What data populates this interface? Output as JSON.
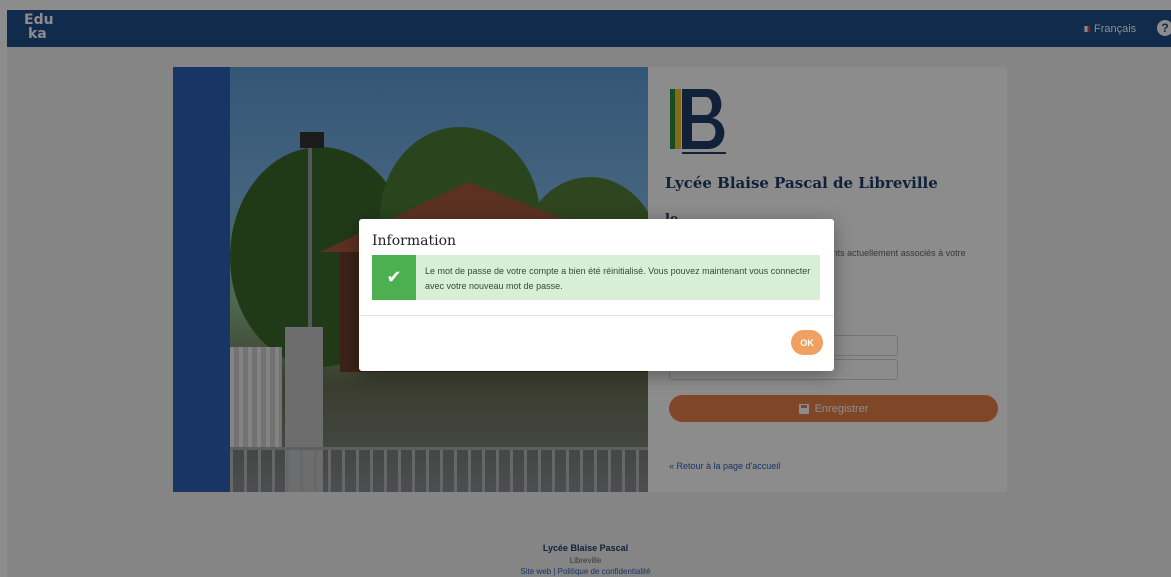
{
  "topbar": {
    "logo_line1": "Edu",
    "logo_line2": "ka",
    "language": "Français",
    "help_symbol": "?"
  },
  "school": {
    "logo_letter": "B",
    "name": "Lycée Blaise Pascal de Libreville"
  },
  "form": {
    "section_title": "le",
    "info_text": "...mot de passe vous déconnectera de ...ents actuellement associés à votre",
    "field_label": "...veau mot de passe:",
    "password_masked": "••••••••••••••",
    "save_label": "Enregistrer",
    "back_link": "« Retour à la page d'accueil"
  },
  "footer": {
    "name": "Lycée Blaise Pascal",
    "city": "Libreville",
    "links": "Site web | Politique de confidentialité"
  },
  "modal": {
    "title": "Information",
    "message": "Le mot de passe de votre compte a bien été réinitialisé. Vous pouvez maintenant vous connecter avec votre nouveau mot de passe.",
    "ok_label": "OK"
  },
  "colors": {
    "topbar": "#1f4f8c",
    "accent_orange": "#e8824a",
    "success_green": "#4caf50",
    "success_bg": "#d8eed6"
  }
}
